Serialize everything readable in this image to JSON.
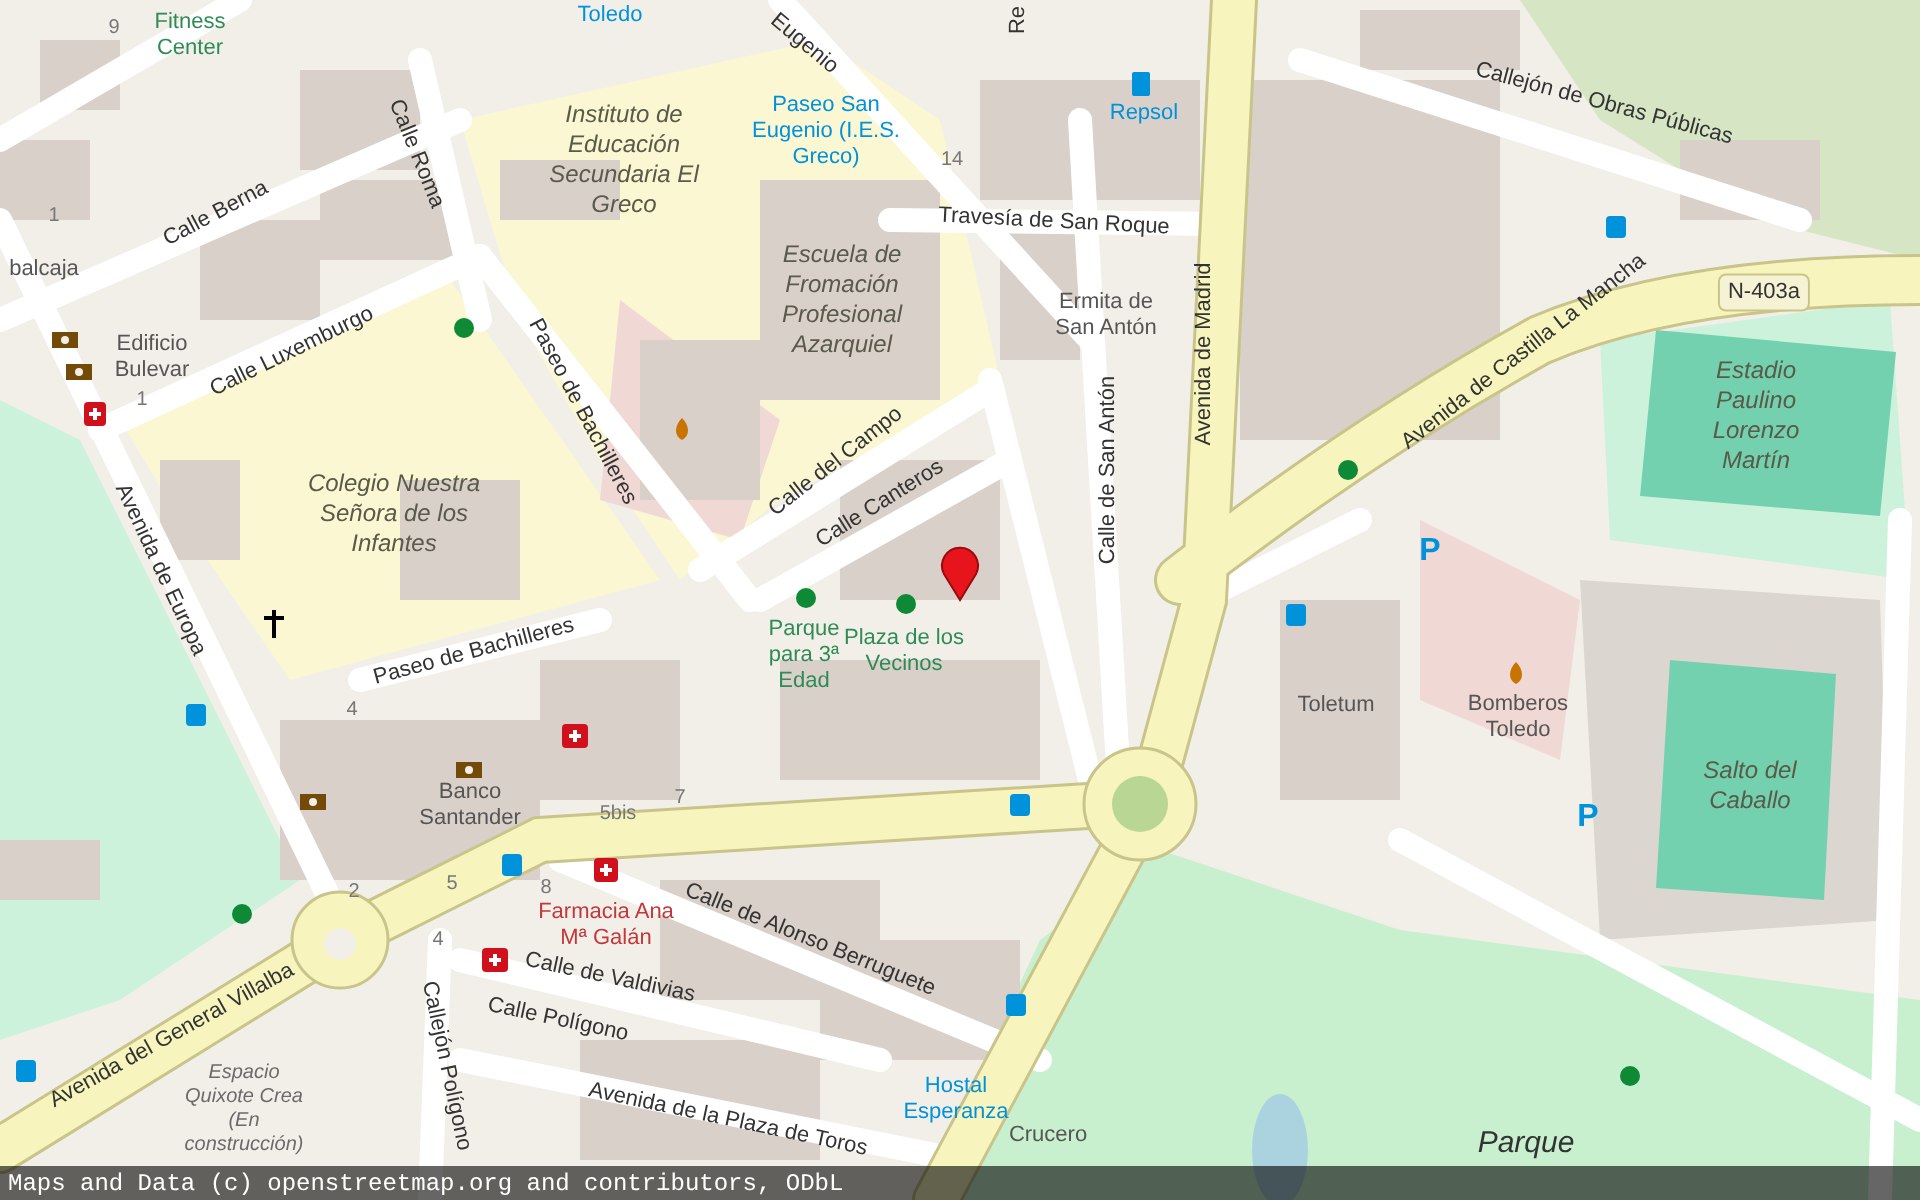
{
  "map": {
    "labels": [
      {
        "text": "Toledo",
        "kind": "poi_blue"
      },
      {
        "text": "Eugenio",
        "kind": "street"
      },
      {
        "text": "Re",
        "kind": "street"
      },
      {
        "text": "9",
        "kind": "number"
      },
      {
        "text": "Fitness Center",
        "kind": "poi_green"
      },
      {
        "text": "Calle Roma",
        "kind": "street"
      },
      {
        "text": "Instituto de Educación Secundaria El Greco",
        "kind": "place"
      },
      {
        "text": "Paseo San Eugenio (I.E.S. Greco)",
        "kind": "poi_blue"
      },
      {
        "text": "Repsol",
        "kind": "poi_blue"
      },
      {
        "text": "Callejón de Obras Públicas",
        "kind": "street"
      },
      {
        "text": "14",
        "kind": "number"
      },
      {
        "text": "Travesía de San Roque",
        "kind": "street"
      },
      {
        "text": "Calle Berna",
        "kind": "street"
      },
      {
        "text": "1",
        "kind": "number"
      },
      {
        "text": "balcaja",
        "kind": "poi"
      },
      {
        "text": "Escuela de Fromación Profesional Azarquiel",
        "kind": "place"
      },
      {
        "text": "Ermita de San Antón",
        "kind": "poi"
      },
      {
        "text": "N-403a",
        "kind": "shield"
      },
      {
        "text": "Avenida de Castilla La Mancha",
        "kind": "street"
      },
      {
        "text": "Avenida de Madrid",
        "kind": "street"
      },
      {
        "text": "Edificio Bulevar",
        "kind": "poi"
      },
      {
        "text": "Calle Luxemburgo",
        "kind": "street"
      },
      {
        "text": "1",
        "kind": "number"
      },
      {
        "text": "Estadio Paulino Lorenzo Martín",
        "kind": "place"
      },
      {
        "text": "Paseo de Bachilleres",
        "kind": "street"
      },
      {
        "text": "Calle del Campo",
        "kind": "street"
      },
      {
        "text": "Calle Canteros",
        "kind": "street"
      },
      {
        "text": "Calle de San Antón",
        "kind": "street"
      },
      {
        "text": "Colegio Nuestra Señora de los Infantes",
        "kind": "place"
      },
      {
        "text": "P",
        "kind": "sign"
      },
      {
        "text": "Avenida de Europa",
        "kind": "street"
      },
      {
        "text": "Paseo de Bachilleres",
        "kind": "street"
      },
      {
        "text": "Parque para 3ª Edad",
        "kind": "poi_green"
      },
      {
        "text": "Plaza de los Vecinos",
        "kind": "poi_green"
      },
      {
        "text": "4",
        "kind": "number"
      },
      {
        "text": "Toletum",
        "kind": "poi"
      },
      {
        "text": "Bomberos Toledo",
        "kind": "poi"
      },
      {
        "text": "Salto del Caballo",
        "kind": "place"
      },
      {
        "text": "Banco Santander",
        "kind": "poi"
      },
      {
        "text": "5bis",
        "kind": "number"
      },
      {
        "text": "7",
        "kind": "number"
      },
      {
        "text": "P",
        "kind": "sign"
      },
      {
        "text": "2",
        "kind": "number"
      },
      {
        "text": "5",
        "kind": "number"
      },
      {
        "text": "8",
        "kind": "number"
      },
      {
        "text": "4",
        "kind": "number"
      },
      {
        "text": "Farmacia Ana Mª Galán",
        "kind": "poi_red"
      },
      {
        "text": "Calle de Alonso Berruguete",
        "kind": "street"
      },
      {
        "text": "Calle de Valdivias",
        "kind": "street"
      },
      {
        "text": "Avenida del General Villalba",
        "kind": "street"
      },
      {
        "text": "Calle Polígono",
        "kind": "street"
      },
      {
        "text": "Espacio Quixote Crea (En construcción)",
        "kind": "place_small"
      },
      {
        "text": "Callejón Polígono",
        "kind": "street"
      },
      {
        "text": "Avenida de la Plaza de Toros",
        "kind": "street"
      },
      {
        "text": "Hostal Esperanza",
        "kind": "poi_blue"
      },
      {
        "text": "Crucero",
        "kind": "poi"
      },
      {
        "text": "Parque",
        "kind": "place_large"
      }
    ]
  },
  "attribution": "Maps and Data (c) openstreetmap.org and contributors, ODbL"
}
